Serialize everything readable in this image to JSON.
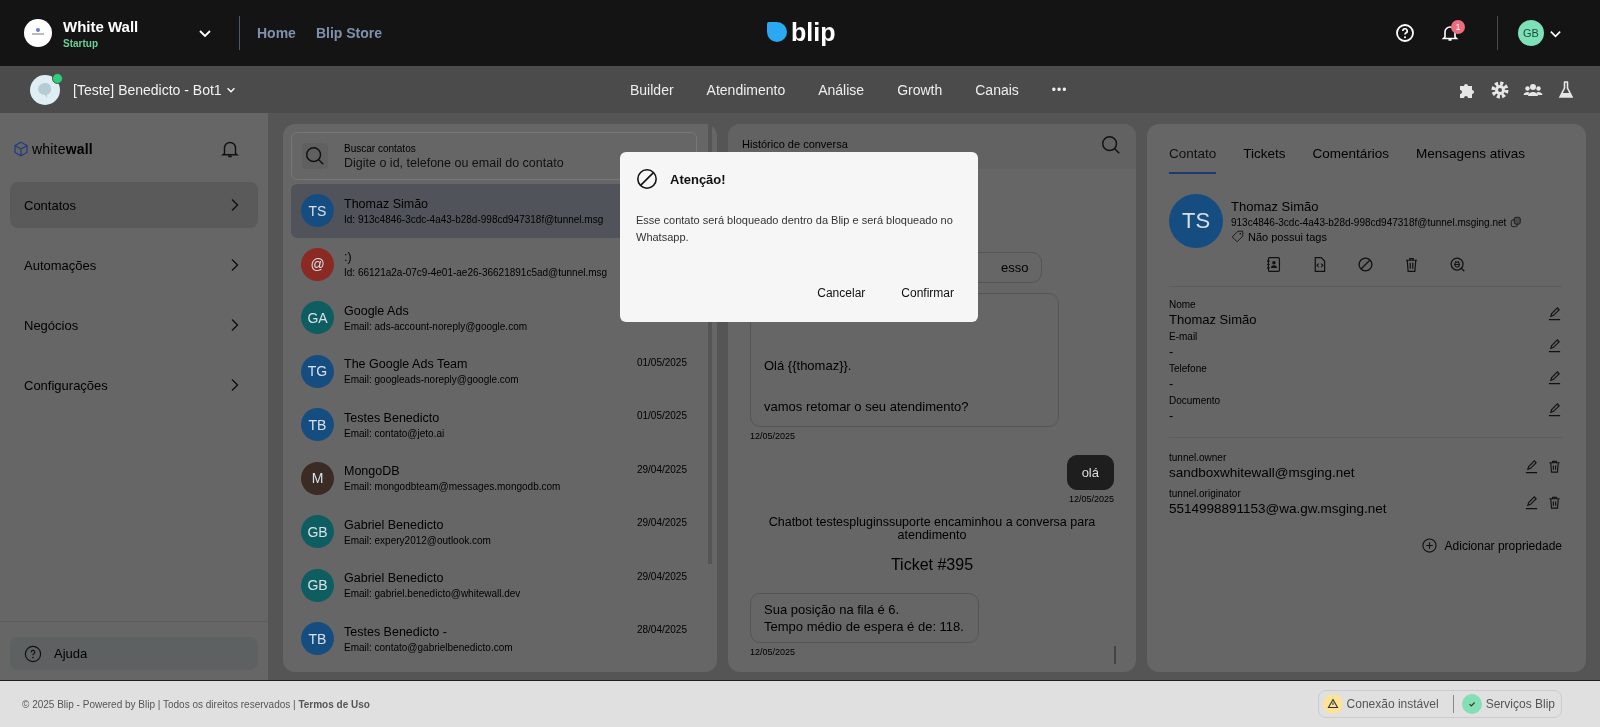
{
  "top_bar": {
    "org_name": "White Wall",
    "org_plan": "Startup",
    "nav": [
      "Home",
      "Blip Store"
    ],
    "logo_text": "blip",
    "notification_count": "1",
    "user_initials": "GB"
  },
  "sub_bar": {
    "bot_name": "[Teste] Benedicto - Bot1",
    "online": true,
    "tabs": [
      {
        "label": "Builder",
        "selected": false
      },
      {
        "label": "Atendimento",
        "selected": false
      },
      {
        "label": "Análise",
        "selected": false
      },
      {
        "label": "Growth",
        "selected": false
      },
      {
        "label": "Canais",
        "selected": false
      }
    ],
    "more": "•••"
  },
  "sidebar": {
    "brand": "white**wall**",
    "items": [
      {
        "label": "Contatos",
        "selected": true
      },
      {
        "label": "Automações",
        "selected": false
      },
      {
        "label": "Negócios",
        "selected": false
      },
      {
        "label": "Configurações",
        "selected": false
      }
    ],
    "help": "Ajuda"
  },
  "contacts": {
    "search": {
      "label": "Buscar contatos",
      "placeholder": "Digite o id, telefone ou email do contato"
    },
    "rows": [
      {
        "initials": "TS",
        "color": "#164d80",
        "name": "Thomaz Simão",
        "detail": "Id: 913c4846-3cdc-4a43-b28d-998cd947318f@tunnel.msg",
        "selected": true
      },
      {
        "initials": "@",
        "color": "#8a2a22",
        "name": ":)",
        "detail": "Id: 66121a2a-07c9-4e01-ae26-36621891c5ad@tunnel.msg",
        "selected": false
      },
      {
        "initials": "GA",
        "color": "#0e5d60",
        "name": "Google Ads",
        "detail": "Email: ads-account-noreply@google.com",
        "selected": false
      },
      {
        "initials": "TG",
        "color": "#164d80",
        "name": "The Google Ads Team",
        "detail": "Email: googleads-noreply@google.com",
        "date": "01/05/2025",
        "selected": false
      },
      {
        "initials": "TB",
        "color": "#164d80",
        "name": "Testes Benedicto",
        "detail": "Email: contato@jeto.ai",
        "date": "01/05/2025",
        "selected": false
      },
      {
        "initials": "M",
        "color": "#3b2b25",
        "name": "MongoDB",
        "detail": "Email: mongodbteam@messages.mongodb.com",
        "date": "29/04/2025",
        "selected": false
      },
      {
        "initials": "GB",
        "color": "#0e5d60",
        "name": "Gabriel Benedicto",
        "detail": "Email: expery2012@outlook.com",
        "date": "29/04/2025",
        "selected": false
      },
      {
        "initials": "GB",
        "color": "#0e5d60",
        "name": "Gabriel Benedicto",
        "detail": "Email: gabriel.benedicto@whitewall.dev",
        "date": "29/04/2025",
        "selected": false
      },
      {
        "initials": "TB",
        "color": "#164d80",
        "name": "Testes Benedicto -",
        "detail": "Email: contato@gabrielbenedicto.com",
        "date": "28/04/2025",
        "selected": false
      }
    ]
  },
  "chat": {
    "title": "Histórico de conversa",
    "messages": [
      {
        "kind": "incoming_cut",
        "lines": [
          "esso"
        ]
      },
      {
        "kind": "template",
        "lines": [
          "Olá {{thomaz}}.",
          "vamos retomar o seu atendimento?"
        ],
        "time": "12/05/2025"
      },
      {
        "kind": "outgoing",
        "lines": [
          "olá"
        ],
        "time": "12/05/2025"
      },
      {
        "kind": "system",
        "lines": [
          "Chatbot testespluginssuporte encaminhou a conversa para atendimento"
        ]
      },
      {
        "kind": "ticket",
        "lines": [
          "Ticket #395"
        ]
      },
      {
        "kind": "incoming",
        "lines": [
          "Sua posição na fila é 6.",
          "Tempo médio de espera é de: 118."
        ],
        "time": "12/05/2025"
      }
    ]
  },
  "contact_panel": {
    "tabs": [
      {
        "label": "Contato",
        "selected": true
      },
      {
        "label": "Tickets",
        "selected": false
      },
      {
        "label": "Comentários",
        "selected": false
      },
      {
        "label": "Mensagens ativas",
        "selected": false
      }
    ],
    "profile": {
      "initials": "TS",
      "name": "Thomaz Simão",
      "id": "913c4846-3cdc-4a43-b28d-998cd947318f@tunnel.msging.net",
      "tags": "Não possui tags"
    },
    "fields": [
      {
        "label": "Nome",
        "value": "Thomaz Simão"
      },
      {
        "label": "E-mail",
        "value": "-"
      },
      {
        "label": "Telefone",
        "value": "-"
      },
      {
        "label": "Documento",
        "value": "-"
      }
    ],
    "extras": [
      {
        "label": "tunnel.owner",
        "value": "sandboxwhitewall@msging.net"
      },
      {
        "label": "tunnel.originator",
        "value": "5514998891153@wa.gw.msging.net"
      }
    ],
    "add_property": "Adicionar propriedade"
  },
  "footer": {
    "copyright": "© 2025 Blip - Powered by Blip | Todos os direitos reservados | **Termos de Uso**",
    "statuses": [
      {
        "kind": "warning",
        "label": "Conexão instável"
      },
      {
        "kind": "ok",
        "label": "Serviços Blip"
      }
    ]
  },
  "dialog": {
    "title": "Atenção!",
    "body": "Esse contato será bloqueado dentro da Blip e será bloqueado no Whatsapp.",
    "buttons": [
      "Cancelar",
      "Confirmar"
    ]
  }
}
